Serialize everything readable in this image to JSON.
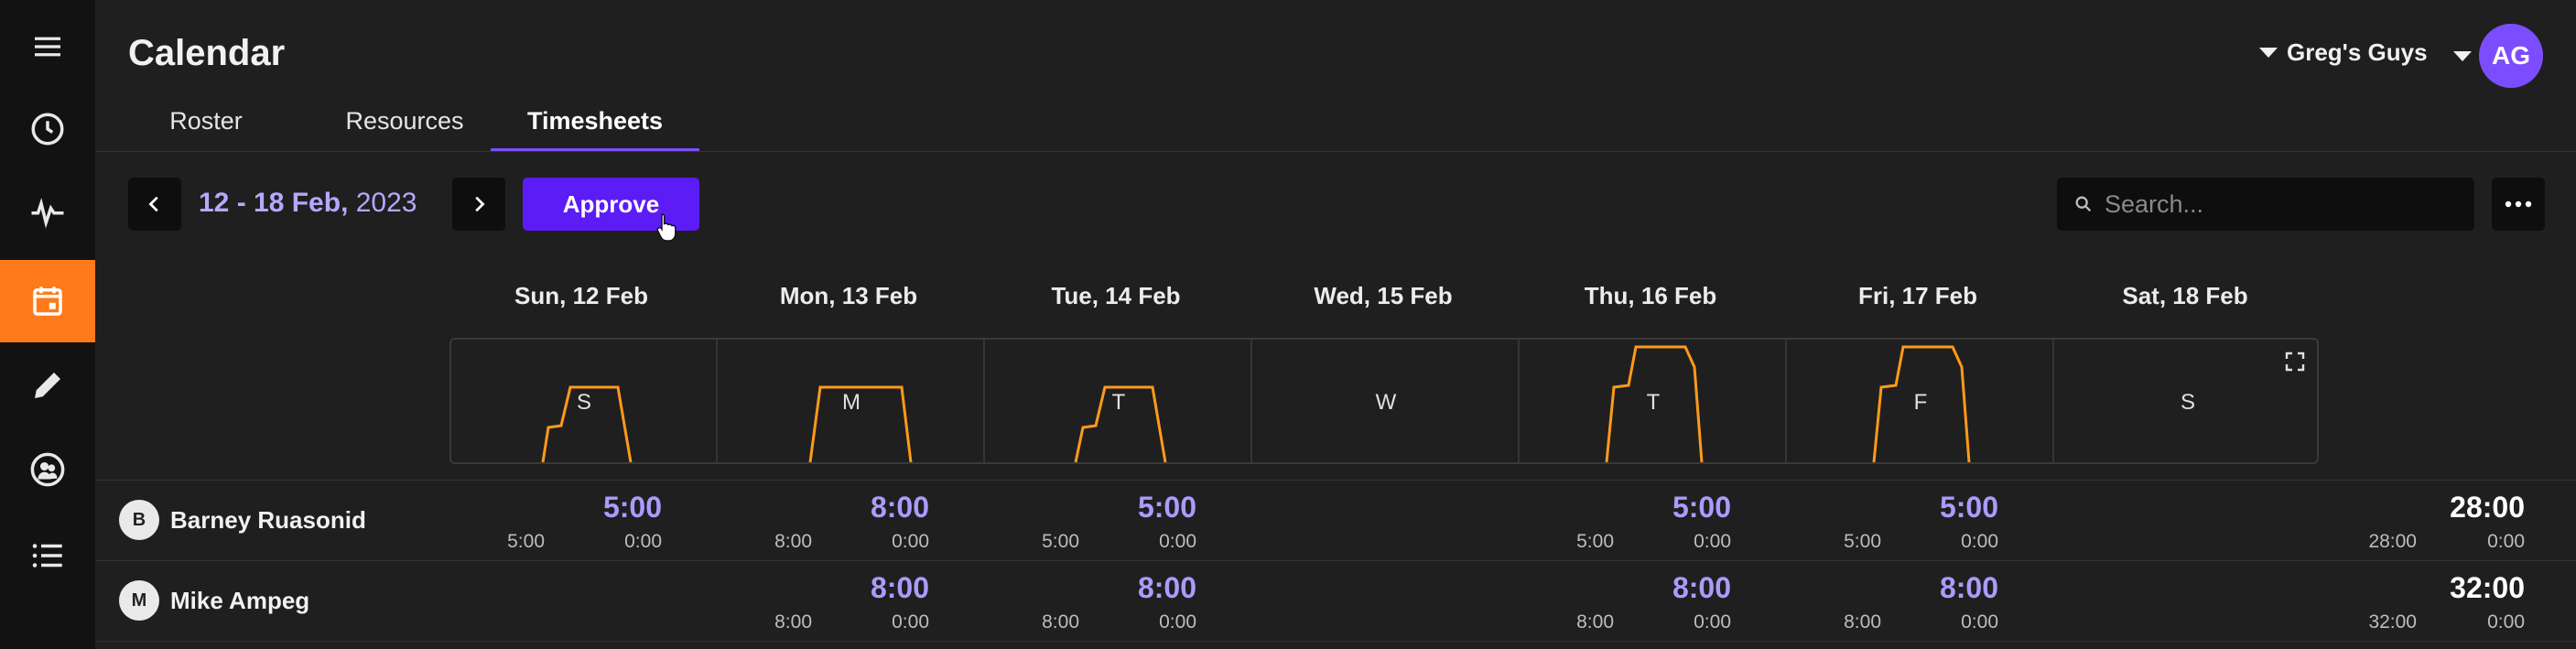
{
  "app": {
    "title": "Calendar"
  },
  "header": {
    "org_name": "Greg's Guys",
    "avatar_initials": "AG",
    "avatar_color": "#7c4dff"
  },
  "sidebar": {
    "items": [
      {
        "icon": "menu-icon"
      },
      {
        "icon": "clock-icon"
      },
      {
        "icon": "activity-icon"
      },
      {
        "icon": "calendar-icon",
        "active": true
      },
      {
        "icon": "pencil-icon"
      },
      {
        "icon": "people-icon"
      },
      {
        "icon": "list-icon"
      }
    ],
    "active_color": "#ff7a1a"
  },
  "tabs": [
    {
      "label": "Roster"
    },
    {
      "label": "Resources"
    },
    {
      "label": "Timesheets",
      "active": true
    }
  ],
  "toolbar": {
    "date_range": "12 - 18 Feb,",
    "date_year": "2023",
    "approve_label": "Approve",
    "search_placeholder": "Search..."
  },
  "days": [
    {
      "label": "Sun, 12 Feb",
      "letter": "S"
    },
    {
      "label": "Mon, 13 Feb",
      "letter": "M"
    },
    {
      "label": "Tue, 14 Feb",
      "letter": "T"
    },
    {
      "label": "Wed, 15 Feb",
      "letter": "W"
    },
    {
      "label": "Thu, 16 Feb",
      "letter": "T"
    },
    {
      "label": "Fri, 17 Feb",
      "letter": "F"
    },
    {
      "label": "Sat, 18 Feb",
      "letter": "S"
    }
  ],
  "rows": [
    {
      "initial": "B",
      "name": "Barney Ruasonid",
      "cells": [
        {
          "day": 0,
          "total": "5:00",
          "a": "5:00",
          "b": "0:00"
        },
        {
          "day": 1,
          "total": "8:00",
          "a": "8:00",
          "b": "0:00"
        },
        {
          "day": 2,
          "total": "5:00",
          "a": "5:00",
          "b": "0:00"
        },
        {
          "day": 4,
          "total": "5:00",
          "a": "5:00",
          "b": "0:00"
        },
        {
          "day": 5,
          "total": "5:00",
          "a": "5:00",
          "b": "0:00"
        }
      ],
      "week": {
        "total": "28:00",
        "a": "28:00",
        "b": "0:00"
      }
    },
    {
      "initial": "M",
      "name": "Mike Ampeg",
      "cells": [
        {
          "day": 1,
          "total": "8:00",
          "a": "8:00",
          "b": "0:00"
        },
        {
          "day": 2,
          "total": "8:00",
          "a": "8:00",
          "b": "0:00"
        },
        {
          "day": 4,
          "total": "8:00",
          "a": "8:00",
          "b": "0:00"
        },
        {
          "day": 5,
          "total": "8:00",
          "a": "8:00",
          "b": "0:00"
        }
      ],
      "week": {
        "total": "32:00",
        "a": "32:00",
        "b": "0:00"
      }
    }
  ],
  "colors": {
    "accent": "#5b1cf5",
    "hours_text": "#a99cff",
    "chart_line": "#ff9a1a"
  }
}
